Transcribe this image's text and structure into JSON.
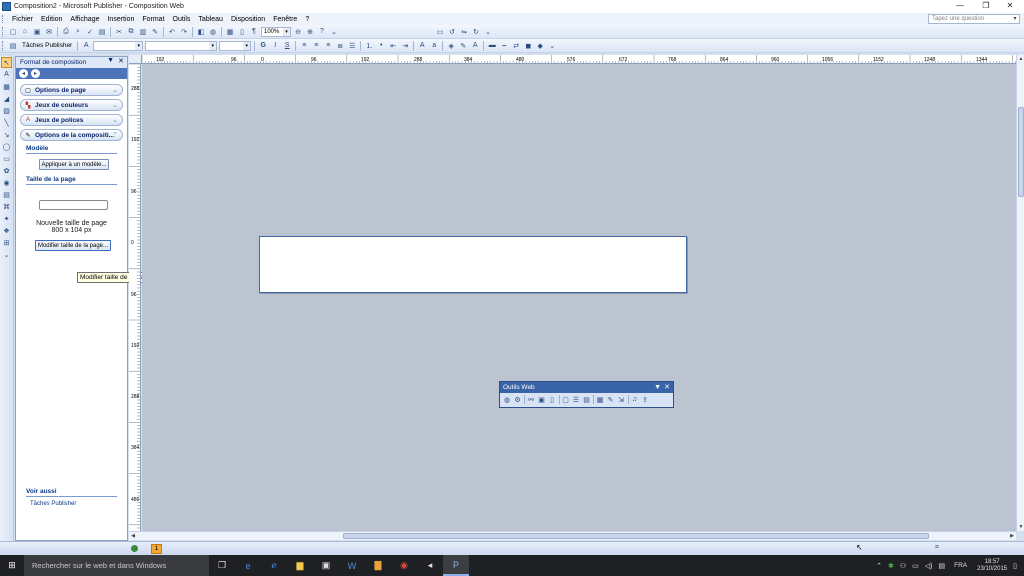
{
  "window": {
    "title": "Composition2 - Microsoft Publisher - Composition Web",
    "controls": {
      "minimize": "—",
      "restore": "❐",
      "close": "✕"
    }
  },
  "menubar": {
    "items": [
      "Fichier",
      "Edition",
      "Affichage",
      "Insertion",
      "Format",
      "Outils",
      "Tableau",
      "Disposition",
      "Fenêtre",
      "?"
    ],
    "help_placeholder": "Tapez une question"
  },
  "toolbar1": {
    "zoom": "100%"
  },
  "toolbar2": {
    "task_label": "Tâches Publisher",
    "bold": "G",
    "italic": "I",
    "underline": "S"
  },
  "taskpane": {
    "title": "Format de composition",
    "sections": [
      {
        "label": "Options de page",
        "icon": "page-icon"
      },
      {
        "label": "Jeux de couleurs",
        "icon": "color-scheme-icon"
      },
      {
        "label": "Jeux de polices",
        "icon": "font-scheme-icon"
      },
      {
        "label": "Options de la compositi...",
        "icon": "publication-options-icon"
      }
    ],
    "model_heading": "Modèle",
    "apply_model_button": "Appliquer à un modèle...",
    "page_size_heading": "Taille de la page",
    "new_size_label": "Nouvelle taille de page",
    "new_size_value": "800 x 104 px",
    "modify_size_button": "Modifier taille de la page...",
    "see_also_heading": "Voir aussi",
    "see_also_link": "Tâches Publisher"
  },
  "tooltip": "Modifier taille de la page...",
  "ruler": {
    "h_labels": [
      "192",
      "96",
      "0",
      "96",
      "192",
      "288",
      "384",
      "480",
      "576",
      "672",
      "768",
      "864",
      "960",
      "1056",
      "1152",
      "1248",
      "1344"
    ],
    "v_labels": [
      "288",
      "192",
      "96",
      "0",
      "96",
      "192",
      "288",
      "384",
      "480"
    ]
  },
  "webtools": {
    "title": "Outils Web"
  },
  "statusbar": {
    "page_number": "1"
  },
  "taskbar": {
    "search_placeholder": "Rechercher sur le web et dans Windows",
    "language": "FRA",
    "time": "18:57",
    "date": "23/10/2015"
  }
}
